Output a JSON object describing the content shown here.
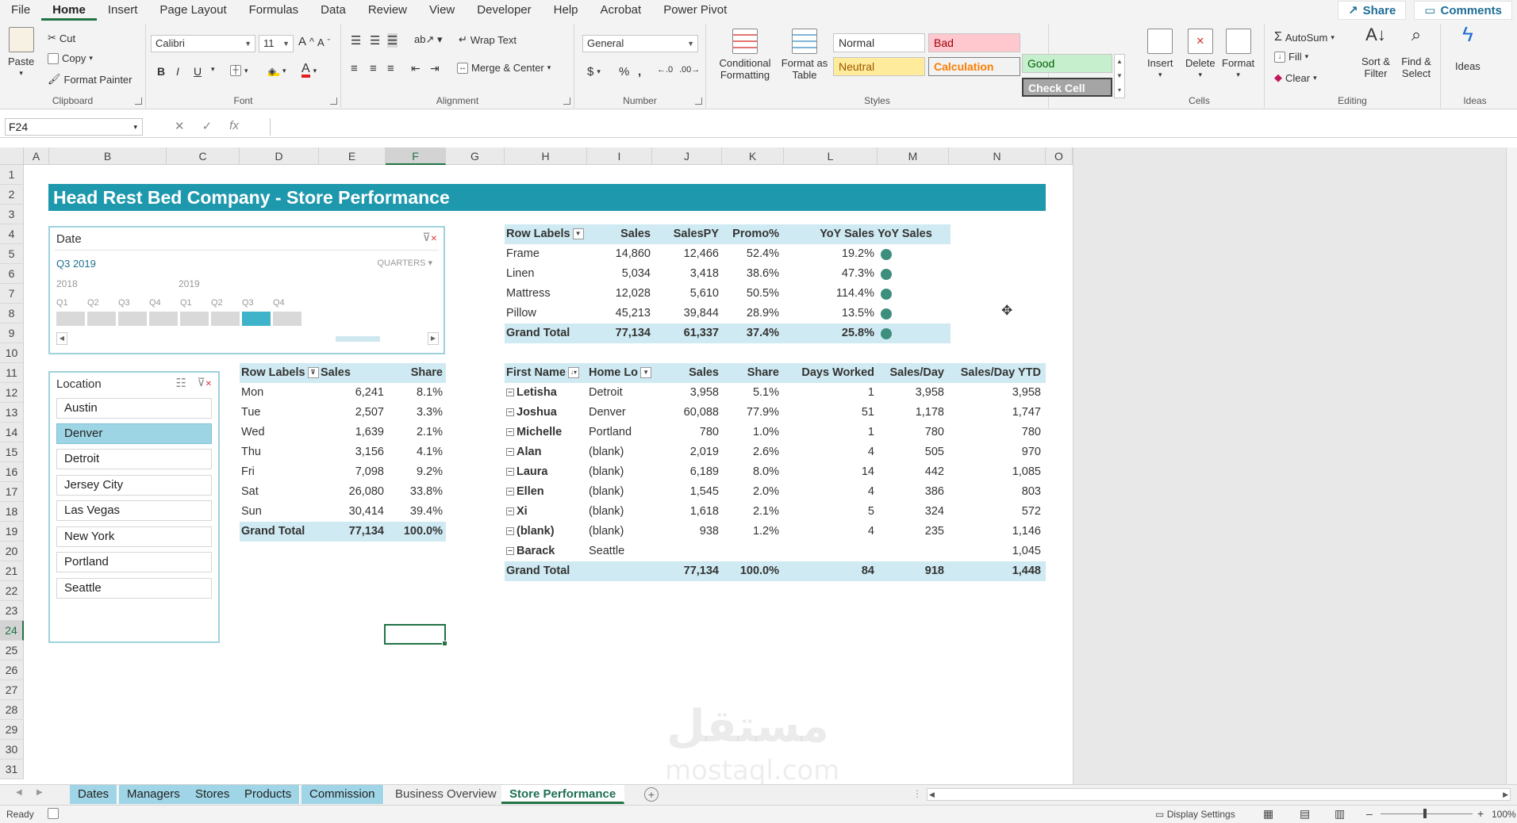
{
  "menu": {
    "tabs": [
      "File",
      "Home",
      "Insert",
      "Page Layout",
      "Formulas",
      "Data",
      "Review",
      "View",
      "Developer",
      "Help",
      "Acrobat",
      "Power Pivot"
    ],
    "share": "Share",
    "comments": "Comments"
  },
  "ribbon": {
    "clipboard": {
      "paste": "Paste",
      "cut": "Cut",
      "copy": "Copy",
      "format_painter": "Format Painter",
      "label": "Clipboard"
    },
    "font": {
      "name": "Calibri",
      "size": "11",
      "bold": "B",
      "italic": "I",
      "underline": "U",
      "label": "Font"
    },
    "alignment": {
      "wrap_text": "Wrap Text",
      "merge_center": "Merge & Center",
      "label": "Alignment"
    },
    "number": {
      "format": "General",
      "label": "Number"
    },
    "styles": {
      "conditional_formatting": "Conditional Formatting",
      "format_as_table": "Format as Table",
      "normal": "Normal",
      "bad": "Bad",
      "good": "Good",
      "neutral": "Neutral",
      "calculation": "Calculation",
      "check_cell": "Check Cell",
      "label": "Styles"
    },
    "cells": {
      "insert": "Insert",
      "delete": "Delete",
      "format": "Format",
      "label": "Cells"
    },
    "editing": {
      "autosum": "AutoSum",
      "fill": "Fill",
      "clear": "Clear",
      "sort_filter": "Sort & Filter",
      "find_select": "Find & Select",
      "label": "Editing"
    },
    "ideas": {
      "ideas": "Ideas",
      "label": "Ideas"
    }
  },
  "formula_bar": {
    "name_box": "F24",
    "formula": ""
  },
  "columns": [
    "A",
    "B",
    "C",
    "D",
    "E",
    "F",
    "G",
    "H",
    "I",
    "J",
    "K",
    "L",
    "M",
    "N",
    "O"
  ],
  "rows": [
    "1",
    "2",
    "3",
    "4",
    "5",
    "6",
    "7",
    "8",
    "9",
    "10",
    "11",
    "12",
    "13",
    "14",
    "15",
    "16",
    "17",
    "18",
    "19",
    "20",
    "21",
    "22",
    "23",
    "24",
    "25",
    "26",
    "27",
    "28",
    "29",
    "30",
    "31"
  ],
  "sheet": {
    "title": "Head Rest Bed Company - Store Performance",
    "date_slicer": {
      "title": "Date",
      "selected": "Q3 2019",
      "level": "QUARTERS",
      "years": [
        "2018",
        "2019"
      ],
      "quarters": [
        "Q1",
        "Q2",
        "Q3",
        "Q4",
        "Q1",
        "Q2",
        "Q3",
        "Q4"
      ]
    },
    "location_slicer": {
      "title": "Location",
      "items": [
        "Austin",
        "Denver",
        "Detroit",
        "Jersey City",
        "Las Vegas",
        "New York",
        "Portland",
        "Seattle"
      ]
    },
    "product_pivot": {
      "headers": [
        "Row Labels",
        "Sales",
        "SalesPY",
        "Promo%",
        "YoY Sales",
        "YoY Sales"
      ],
      "rows": [
        [
          "Frame",
          "14,860",
          "12,466",
          "52.4%",
          "19.2%"
        ],
        [
          "Linen",
          "5,034",
          "3,418",
          "38.6%",
          "47.3%"
        ],
        [
          "Mattress",
          "12,028",
          "5,610",
          "50.5%",
          "114.4%"
        ],
        [
          "Pillow",
          "45,213",
          "39,844",
          "28.9%",
          "13.5%"
        ]
      ],
      "total": [
        "Grand Total",
        "77,134",
        "61,337",
        "37.4%",
        "25.8%"
      ],
      "indicator_color": "#3e8e7e"
    },
    "day_pivot": {
      "headers": [
        "Row Labels",
        "Sales",
        "Share"
      ],
      "rows": [
        [
          "Mon",
          "6,241",
          "8.1%"
        ],
        [
          "Tue",
          "2,507",
          "3.3%"
        ],
        [
          "Wed",
          "1,639",
          "2.1%"
        ],
        [
          "Thu",
          "3,156",
          "4.1%"
        ],
        [
          "Fri",
          "7,098",
          "9.2%"
        ],
        [
          "Sat",
          "26,080",
          "33.8%"
        ],
        [
          "Sun",
          "30,414",
          "39.4%"
        ]
      ],
      "total": [
        "Grand Total",
        "77,134",
        "100.0%"
      ]
    },
    "manager_pivot": {
      "headers": [
        "First Name",
        "Home Lo",
        "Sales",
        "Share",
        "Days Worked",
        "Sales/Day",
        "Sales/Day YTD"
      ],
      "rows": [
        [
          "Letisha",
          "Detroit",
          "3,958",
          "5.1%",
          "1",
          "3,958",
          "3,958"
        ],
        [
          "Joshua",
          "Denver",
          "60,088",
          "77.9%",
          "51",
          "1,178",
          "1,747"
        ],
        [
          "Michelle",
          "Portland",
          "780",
          "1.0%",
          "1",
          "780",
          "780"
        ],
        [
          "Alan",
          "(blank)",
          "2,019",
          "2.6%",
          "4",
          "505",
          "970"
        ],
        [
          "Laura",
          "(blank)",
          "6,189",
          "8.0%",
          "14",
          "442",
          "1,085"
        ],
        [
          "Ellen",
          "(blank)",
          "1,545",
          "2.0%",
          "4",
          "386",
          "803"
        ],
        [
          "Xi",
          "(blank)",
          "1,618",
          "2.1%",
          "5",
          "324",
          "572"
        ],
        [
          "(blank)",
          "(blank)",
          "938",
          "1.2%",
          "4",
          "235",
          "1,146"
        ],
        [
          "Barack",
          "Seattle",
          "",
          "",
          "",
          "",
          "1,045"
        ]
      ],
      "total": [
        "Grand Total",
        "",
        "77,134",
        "100.0%",
        "84",
        "918",
        "1,448"
      ]
    }
  },
  "sheet_tabs": [
    "Dates",
    "Managers",
    "Stores",
    "Products",
    "Commission",
    "Business Overview",
    "Store Performance"
  ],
  "active_sheet": "Store Performance",
  "status": {
    "ready": "Ready",
    "display_settings": "Display Settings",
    "zoom": "100%"
  },
  "watermark": {
    "arabic": "مستقل",
    "latin": "mostaql.com"
  },
  "colors": {
    "banner": "#1e98ad",
    "excel_green": "#217346",
    "slicer_selected": "#9dd5e4",
    "pivot_header": "#cfeaf2"
  }
}
